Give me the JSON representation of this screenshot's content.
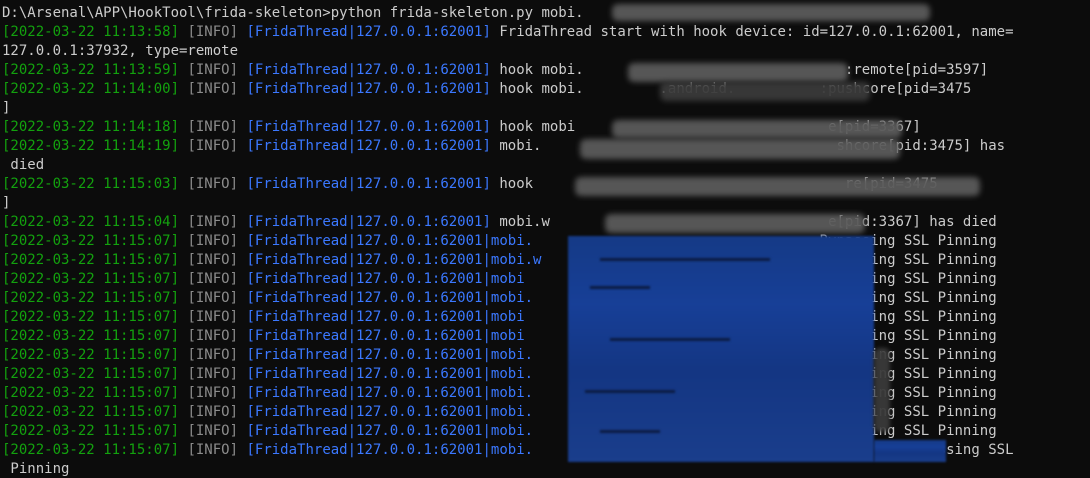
{
  "terminal": {
    "prompt_line": "D:\\Arsenal\\APP\\HookTool\\frida-skeleton>python frida-skeleton.py mobi.",
    "logs": [
      {
        "ts": "[2022-03-22 11:13:58]",
        "level": "[INFO]",
        "thread": "[FridaThread|127.0.0.1:62001]",
        "msg": "FridaThread start with hook device: id=127.0.0.1:62001, name="
      },
      {
        "cont": "127.0.0.1:37932, type=remote"
      },
      {
        "ts": "[2022-03-22 11:13:59]",
        "level": "[INFO]",
        "thread": "[FridaThread|127.0.0.1:62001]",
        "msg": "hook mobi.                               :remote[pid=3597]"
      },
      {
        "ts": "[2022-03-22 11:14:00]",
        "level": "[INFO]",
        "thread": "[FridaThread|127.0.0.1:62001]",
        "msg": "hook mobi.         .android.          :pushcore[pid=3475"
      },
      {
        "cont": "]"
      },
      {
        "ts": "[2022-03-22 11:14:18]",
        "level": "[INFO]",
        "thread": "[FridaThread|127.0.0.1:62001]",
        "msg": "hook mobi                              e[pid=3367]"
      },
      {
        "ts": "[2022-03-22 11:14:19]",
        "level": "[INFO]",
        "thread": "[FridaThread|127.0.0.1:62001]",
        "msg": "mobi.                                   shcore[pid:3475] has"
      },
      {
        "cont": " died"
      },
      {
        "ts": "[2022-03-22 11:15:03]",
        "level": "[INFO]",
        "thread": "[FridaThread|127.0.0.1:62001]",
        "msg": "hook                                     re[pid=3475"
      },
      {
        "cont": "]"
      },
      {
        "ts": "[2022-03-22 11:15:04]",
        "level": "[INFO]",
        "thread": "[FridaThread|127.0.0.1:62001]",
        "msg": "mobi.w                                 e[pid:3367] has died"
      },
      {
        "ts": "[2022-03-22 11:15:07]",
        "level": "[INFO]",
        "thread": "[FridaThread|127.0.0.1:62001|mobi.",
        "msg": "                                 Bypassing SSL Pinning"
      },
      {
        "ts": "[2022-03-22 11:15:07]",
        "level": "[INFO]",
        "thread": "[FridaThread|127.0.0.1:62001|mobi.w",
        "msg": "                                Bypassing SSL Pinning"
      },
      {
        "ts": "[2022-03-22 11:15:07]",
        "level": "[INFO]",
        "thread": "[FridaThread|127.0.0.1:62001|mobi",
        "msg": "                                  Bypassing SSL Pinning"
      },
      {
        "ts": "[2022-03-22 11:15:07]",
        "level": "[INFO]",
        "thread": "[FridaThread|127.0.0.1:62001|mobi.",
        "msg": "                                 Bypassing SSL Pinning"
      },
      {
        "ts": "[2022-03-22 11:15:07]",
        "level": "[INFO]",
        "thread": "[FridaThread|127.0.0.1:62001|mobi",
        "msg": "                                  Bypassing SSL Pinning"
      },
      {
        "ts": "[2022-03-22 11:15:07]",
        "level": "[INFO]",
        "thread": "[FridaThread|127.0.0.1:62001|mobi",
        "msg": "                                  Bypassing SSL Pinning"
      },
      {
        "ts": "[2022-03-22 11:15:07]",
        "level": "[INFO]",
        "thread": "[FridaThread|127.0.0.1:62001|mobi.",
        "msg": "                                 Bypassing SSL Pinning"
      },
      {
        "ts": "[2022-03-22 11:15:07]",
        "level": "[INFO]",
        "thread": "[FridaThread|127.0.0.1:62001|mobi.",
        "msg": "                                 Bypassing SSL Pinning"
      },
      {
        "ts": "[2022-03-22 11:15:07]",
        "level": "[INFO]",
        "thread": "[FridaThread|127.0.0.1:62001|mobi.",
        "msg": "                                 Bypassing SSL Pinning"
      },
      {
        "ts": "[2022-03-22 11:15:07]",
        "level": "[INFO]",
        "thread": "[FridaThread|127.0.0.1:62001|mobi.",
        "msg": "                                 Bypassing SSL Pinning"
      },
      {
        "ts": "[2022-03-22 11:15:07]",
        "level": "[INFO]",
        "thread": "[FridaThread|127.0.0.1:62001|mobi.",
        "msg": "                                 Bypassing SSL Pinning"
      },
      {
        "ts": "[2022-03-22 11:15:07]",
        "level": "[INFO]",
        "thread": "[FridaThread|127.0.0.1:62001|mobi.",
        "msg": "                                           Bypassing SSL"
      },
      {
        "cont": " Pinning"
      }
    ]
  },
  "colors": {
    "background": "#0c0c0c",
    "timestamp": "#13a10e",
    "level": "#8c8c8c",
    "thread": "#3b78ff",
    "text": "#cccccc"
  }
}
